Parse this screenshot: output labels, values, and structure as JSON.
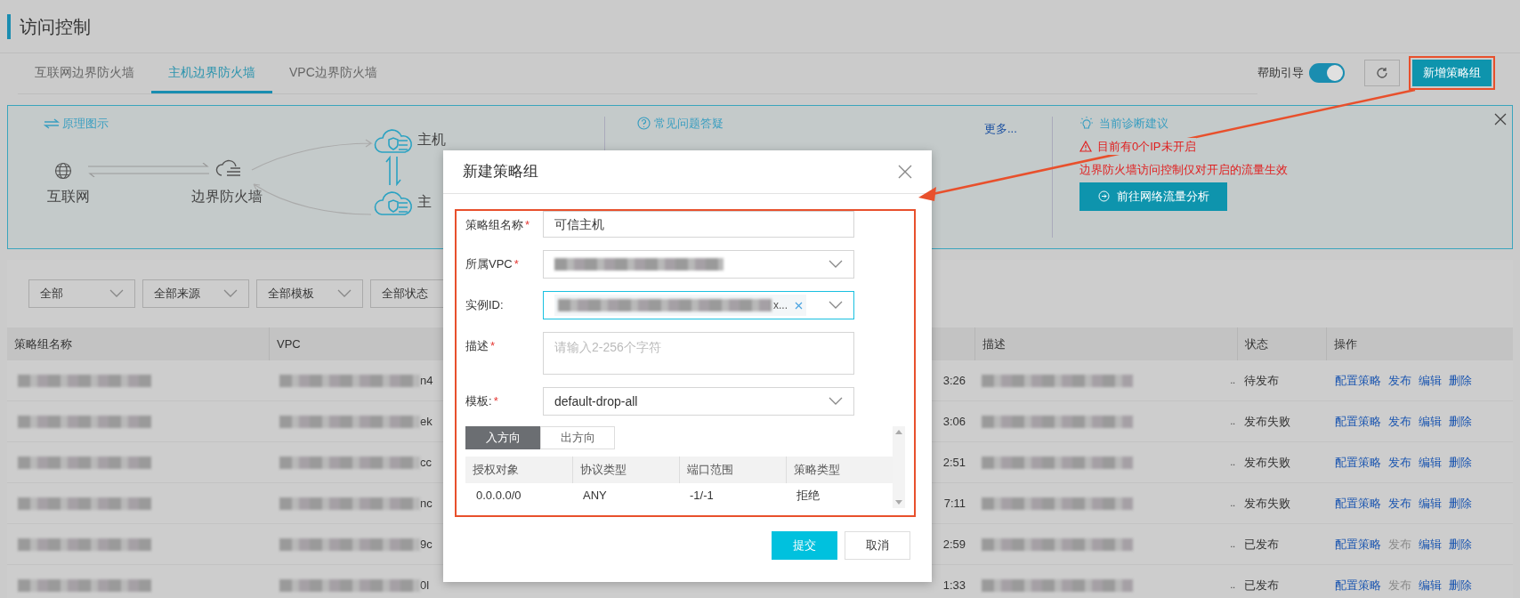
{
  "page": {
    "title": "访问控制"
  },
  "tabs": [
    {
      "label": "互联网边界防火墙",
      "selected": false
    },
    {
      "label": "主机边界防火墙",
      "selected": true
    },
    {
      "label": "VPC边界防火墙",
      "selected": false
    }
  ],
  "toolbar": {
    "help_label": "帮助引导",
    "help_on": true,
    "create_button": "新增策略组"
  },
  "banner": {
    "diagram": {
      "title": "原理图示",
      "internet": "互联网",
      "firewall": "边界防火墙",
      "hosts": [
        "主机",
        "主"
      ]
    },
    "faq": {
      "title": "常见问题答疑",
      "more": "更多..."
    },
    "diagnosis": {
      "title": "当前诊断建议",
      "warning": "目前有0个IP未开启",
      "note": "边界防火墙访问控制仅对开启的流量生效",
      "button": "前往网络流量分析"
    }
  },
  "filters": [
    "全部",
    "全部来源",
    "全部模板",
    "全部状态"
  ],
  "table": {
    "columns": [
      "策略组名称",
      "VPC",
      "描述",
      "状态",
      "操作"
    ],
    "rows": [
      {
        "vpc_tail": "n4",
        "time_tail": "3:26",
        "desc_tail": "..",
        "status": "待发布",
        "actions": [
          {
            "label": "配置策略",
            "disabled": false
          },
          {
            "label": "发布",
            "disabled": false
          },
          {
            "label": "编辑",
            "disabled": false
          },
          {
            "label": "删除",
            "disabled": false
          }
        ]
      },
      {
        "vpc_tail": "ek",
        "time_tail": "3:06",
        "desc_tail": "..",
        "status": "发布失败",
        "actions": [
          {
            "label": "配置策略",
            "disabled": false
          },
          {
            "label": "发布",
            "disabled": false
          },
          {
            "label": "编辑",
            "disabled": false
          },
          {
            "label": "删除",
            "disabled": false
          }
        ]
      },
      {
        "vpc_tail": "cc",
        "time_tail": "2:51",
        "desc_tail": "..",
        "status": "发布失败",
        "actions": [
          {
            "label": "配置策略",
            "disabled": false
          },
          {
            "label": "发布",
            "disabled": false
          },
          {
            "label": "编辑",
            "disabled": false
          },
          {
            "label": "删除",
            "disabled": false
          }
        ]
      },
      {
        "vpc_tail": "nc",
        "time_tail": "7:11",
        "desc_tail": "..",
        "status": "发布失败",
        "actions": [
          {
            "label": "配置策略",
            "disabled": false
          },
          {
            "label": "发布",
            "disabled": false
          },
          {
            "label": "编辑",
            "disabled": false
          },
          {
            "label": "删除",
            "disabled": false
          }
        ]
      },
      {
        "vpc_tail": "9c",
        "time_tail": "2:59",
        "desc_tail": "..",
        "status": "已发布",
        "actions": [
          {
            "label": "配置策略",
            "disabled": false
          },
          {
            "label": "发布",
            "disabled": true
          },
          {
            "label": "编辑",
            "disabled": false
          },
          {
            "label": "删除",
            "disabled": false
          }
        ]
      },
      {
        "vpc_tail": "0l",
        "time_tail": "1:33",
        "desc_tail": "..",
        "status": "已发布",
        "actions": [
          {
            "label": "配置策略",
            "disabled": false
          },
          {
            "label": "发布",
            "disabled": true
          },
          {
            "label": "编辑",
            "disabled": false
          },
          {
            "label": "删除",
            "disabled": false
          }
        ]
      }
    ]
  },
  "modal": {
    "title": "新建策略组",
    "required_mark": "*",
    "fields": [
      {
        "label": "策略组名称",
        "required": true,
        "kind": "text",
        "value": "可信主机"
      },
      {
        "label": "所属VPC",
        "required": true,
        "kind": "select"
      },
      {
        "label": "实例ID:",
        "required": false,
        "kind": "multiselect",
        "tag": "x...",
        "focused": true
      },
      {
        "label": "描述",
        "required": true,
        "kind": "textarea",
        "placeholder": "请输入2-256个字符"
      },
      {
        "label": "模板:",
        "required": true,
        "kind": "select",
        "value": "default-drop-all"
      }
    ],
    "direction_tabs": [
      {
        "label": "入方向",
        "selected": true
      },
      {
        "label": "出方向",
        "selected": false
      }
    ],
    "rules": {
      "columns": [
        "授权对象",
        "协议类型",
        "端口范围",
        "策略类型"
      ],
      "rows": [
        [
          "0.0.0.0/0",
          "ANY",
          "-1/-1",
          "拒绝"
        ]
      ]
    },
    "buttons": [
      {
        "label": "提交",
        "kind": "primary"
      },
      {
        "label": "取消",
        "kind": "default"
      }
    ]
  }
}
